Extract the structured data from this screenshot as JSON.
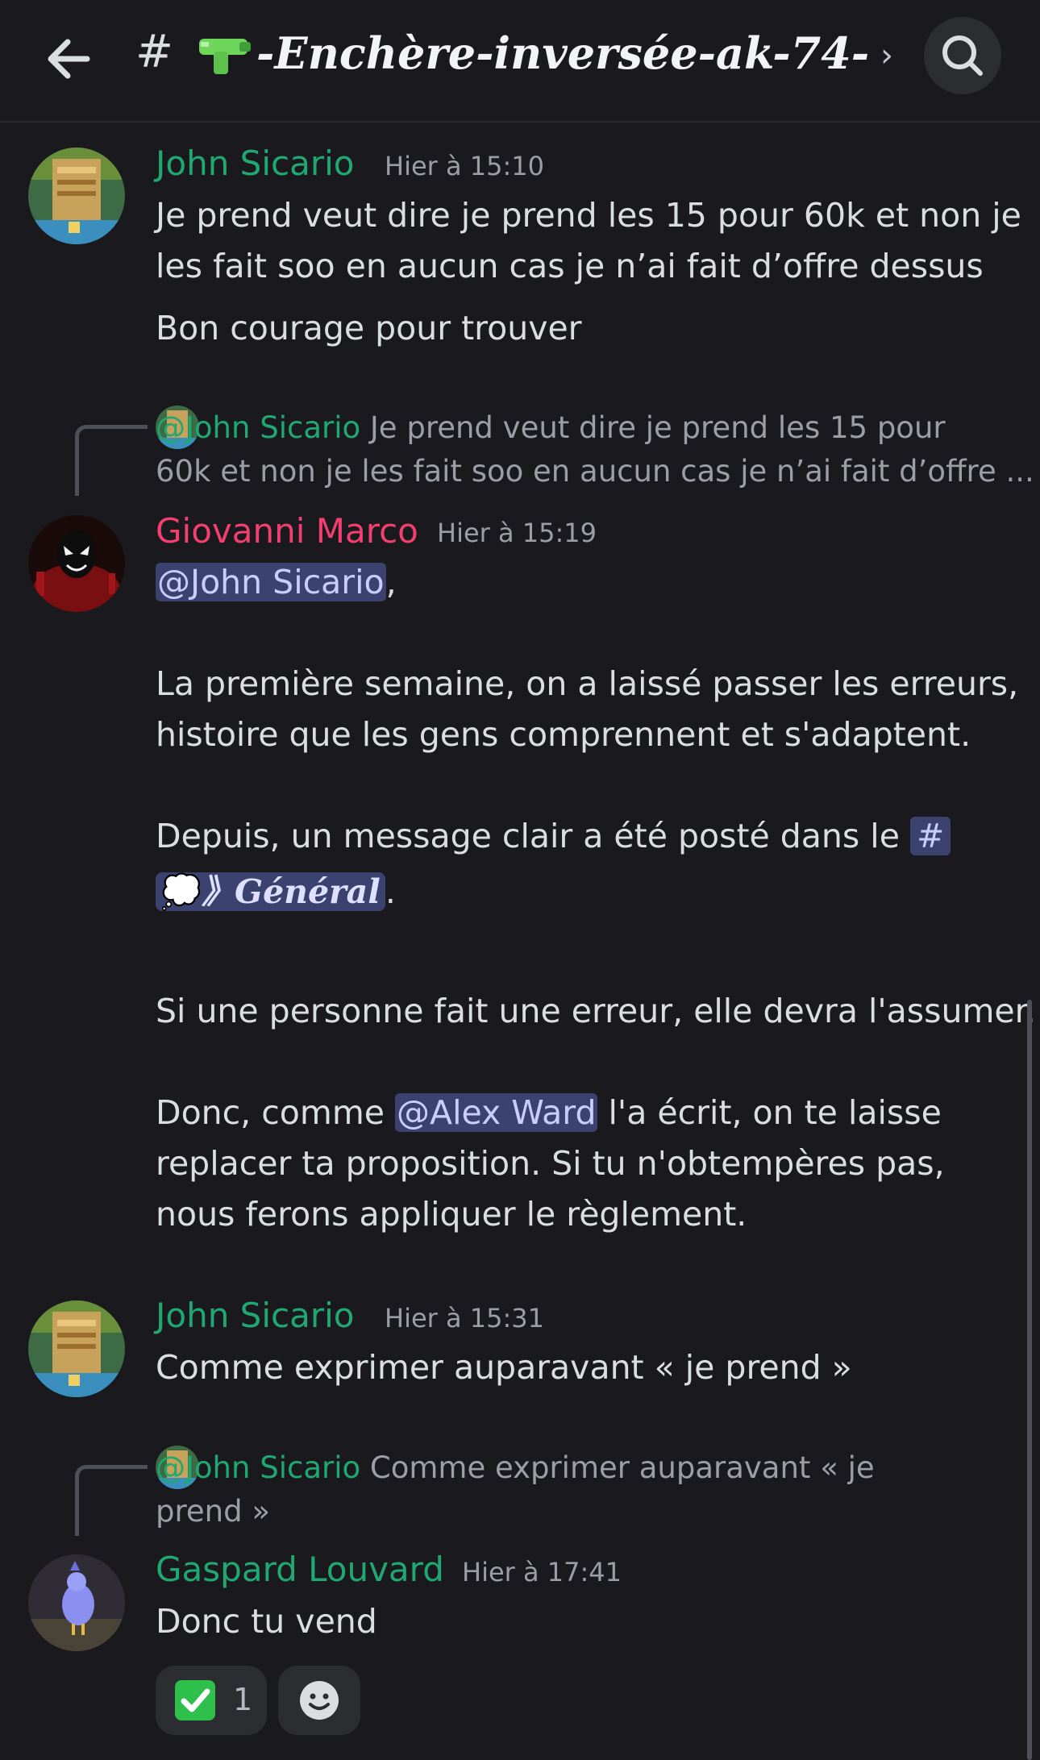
{
  "header": {
    "channel_title": "-Enchère-inversée-ak-74-...",
    "hash": "#",
    "chevron": "›",
    "icons": [
      "back-arrow-icon",
      "gun-emoji-icon",
      "chevron-right-icon",
      "search-icon"
    ]
  },
  "messages": [
    {
      "author": "John Sicario",
      "time": "Hier à 15:10",
      "lines": [
        "Je prend veut dire je prend les 15 pour 60k et non je",
        "les fait soo en aucun cas je n’ai fait d’offre dessus",
        "Bon courage pour trouver"
      ]
    },
    {
      "reply": {
        "mention": "@John Sicario",
        "text_line1": "Je prend veut dire je prend les 15 pour",
        "text_line2": "60k et non je les fait soo en aucun cas je n’ai fait d’offre ..."
      },
      "author": "Giovanni Marco",
      "time": "Hier à 15:19",
      "mention_user": "@John Sicario",
      "comma": ",",
      "para1_line1": "La première semaine, on a laissé passer les erreurs,",
      "para1_line2": "histoire que les gens comprennent et s'adaptent.",
      "para2_prefix": "Depuis, un message clair a été posté dans le",
      "channel_hash": "#",
      "channel_name": "》Général",
      "para2_suffix": ".",
      "para3": "Si une personne fait une erreur, elle devra l'assumer.",
      "para4_prefix": "Donc, comme",
      "mention_alex": "@Alex Ward",
      "para4_suffix": "l'a écrit, on te laisse",
      "para4_line2": "replacer ta proposition. Si tu n'obtempères pas,",
      "para4_line3": "nous ferons appliquer le règlement."
    },
    {
      "author": "John Sicario",
      "time": "Hier à 15:31",
      "lines": [
        "Comme exprimer auparavant « je prend »"
      ]
    },
    {
      "reply": {
        "mention": "@John Sicario",
        "text_line1": "Comme exprimer auparavant « je",
        "text_line2": "prend »"
      },
      "author": "Gaspard Louvard",
      "time": "Hier à 17:41",
      "lines": [
        "Donc tu vend"
      ],
      "reactions": [
        {
          "emoji": "check-mark-icon",
          "count": "1"
        },
        {
          "emoji": "add-reaction-icon",
          "count": ""
        }
      ]
    }
  ],
  "colors": {
    "background": "#1a1a1e",
    "green_name": "#1fa872",
    "pink_name": "#f23f6e",
    "mention_bg": "#3c4270"
  }
}
